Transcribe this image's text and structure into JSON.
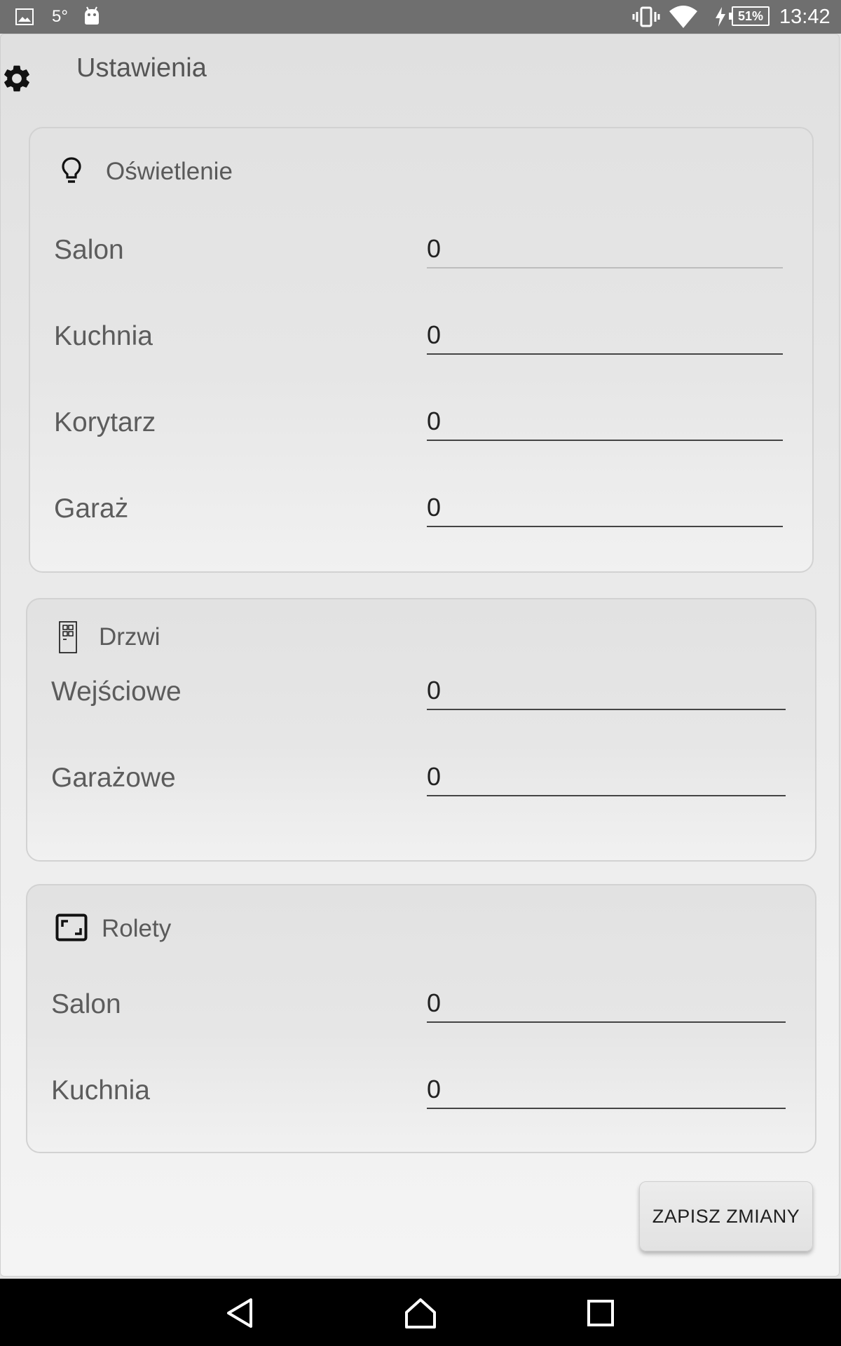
{
  "status_bar": {
    "temperature": "5°",
    "battery": "51%",
    "time": "13:42"
  },
  "page": {
    "title": "Ustawienia"
  },
  "sections": [
    {
      "title": "Oświetlenie",
      "icon": "lightbulb-icon",
      "rows": [
        {
          "label": "Salon",
          "value": "0"
        },
        {
          "label": "Kuchnia",
          "value": "0"
        },
        {
          "label": "Korytarz",
          "value": "0"
        },
        {
          "label": "Garaż",
          "value": "0"
        }
      ]
    },
    {
      "title": "Drzwi",
      "icon": "door-icon",
      "rows": [
        {
          "label": "Wejściowe",
          "value": "0"
        },
        {
          "label": "Garażowe",
          "value": "0"
        }
      ]
    },
    {
      "title": "Rolety",
      "icon": "blinds-frame-icon",
      "rows": [
        {
          "label": "Salon",
          "value": "0"
        },
        {
          "label": "Kuchnia",
          "value": "0"
        }
      ]
    }
  ],
  "actions": {
    "save_label": "ZAPISZ ZMIANY"
  }
}
